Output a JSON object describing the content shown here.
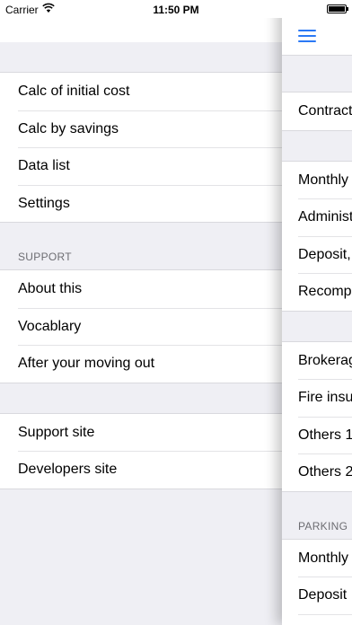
{
  "status_bar": {
    "carrier": "Carrier",
    "time": "11:50 PM",
    "wifi_icon": "wifi-icon",
    "battery_icon": "battery-icon",
    "battery_level": 1.0
  },
  "menu": {
    "group1": [
      "Calc of initial cost",
      "Calc by savings",
      "Data list",
      "Settings"
    ],
    "support_label": "SUPPORT",
    "group2": [
      "About this",
      "Vocablary",
      "After your moving out"
    ],
    "group3": [
      "Support site",
      "Developers site"
    ]
  },
  "panel": {
    "menu_icon": "hamburger-menu-icon",
    "accent_color": "#2b79f5",
    "group1": [
      "Contract"
    ],
    "group2": [
      "Monthly",
      "Administ",
      "Deposit,",
      "Recomp"
    ],
    "group3": [
      "Brokerag",
      "Fire insu",
      "Others 1",
      "Others 2"
    ],
    "parking_label": "PARKING",
    "group4": [
      "Monthly",
      "Deposit"
    ]
  }
}
